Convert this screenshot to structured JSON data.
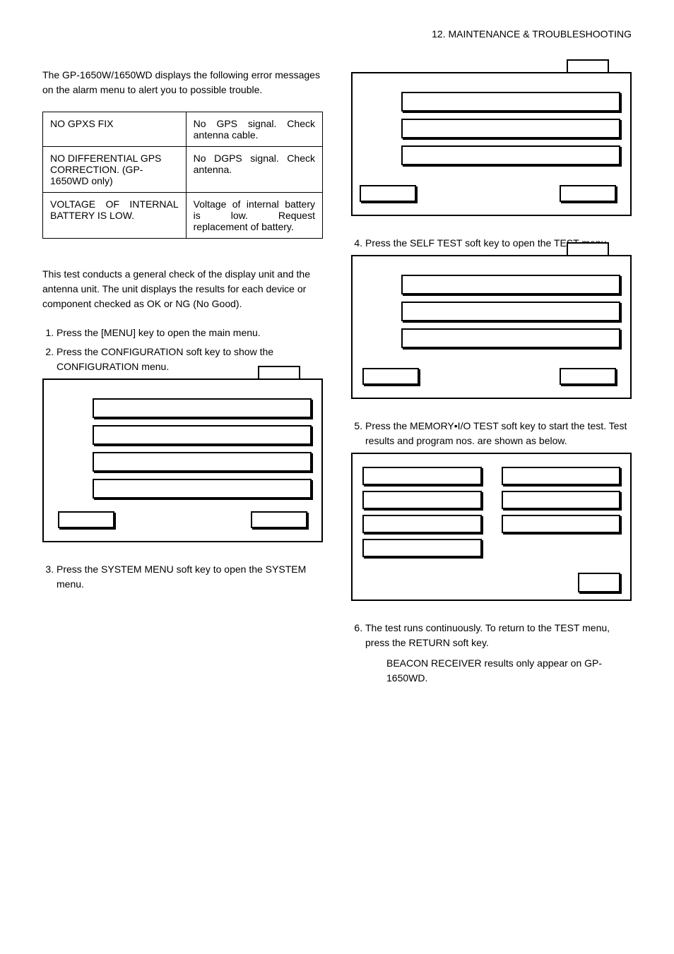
{
  "header": "12. MAINTENANCE & TROUBLESHOOTING",
  "intro": "The GP-1650W/1650WD displays the following error messages on the alarm menu to alert you to possible trouble.",
  "table": {
    "rows": [
      {
        "msg": "NO GPXS FIX",
        "meaning": "No GPS signal. Check antenna cable."
      },
      {
        "msg": "NO DIFFERENTIAL GPS CORRECTION. (GP-1650WD only)",
        "meaning": "No DGPS signal. Check antenna."
      },
      {
        "msg": "VOLTAGE OF INTERNAL BATTERY IS LOW.",
        "meaning": "Voltage of internal battery is low. Request replacement of battery."
      }
    ]
  },
  "diag_intro": "This test conducts a general check of the display unit and the antenna unit. The unit displays the results for each device or component checked as OK or NG (No Good).",
  "steps_left": [
    "Press the [MENU] key to open the main menu.",
    "Press the CONFIGURATION soft key to show the CONFIGURATION menu."
  ],
  "step3": "Press the SYSTEM MENU soft key to open the SYSTEM menu.",
  "step4": "Press the SELF TEST soft key to open the TEST menu.",
  "step5": "Press the MEMORY•I/O TEST soft key to start the test. Test results and program nos. are shown as below.",
  "step6": "The test runs continuously. To return to the TEST menu, press the RETURN soft key.",
  "note": "BEACON RECEIVER results only appear on GP-1650WD."
}
